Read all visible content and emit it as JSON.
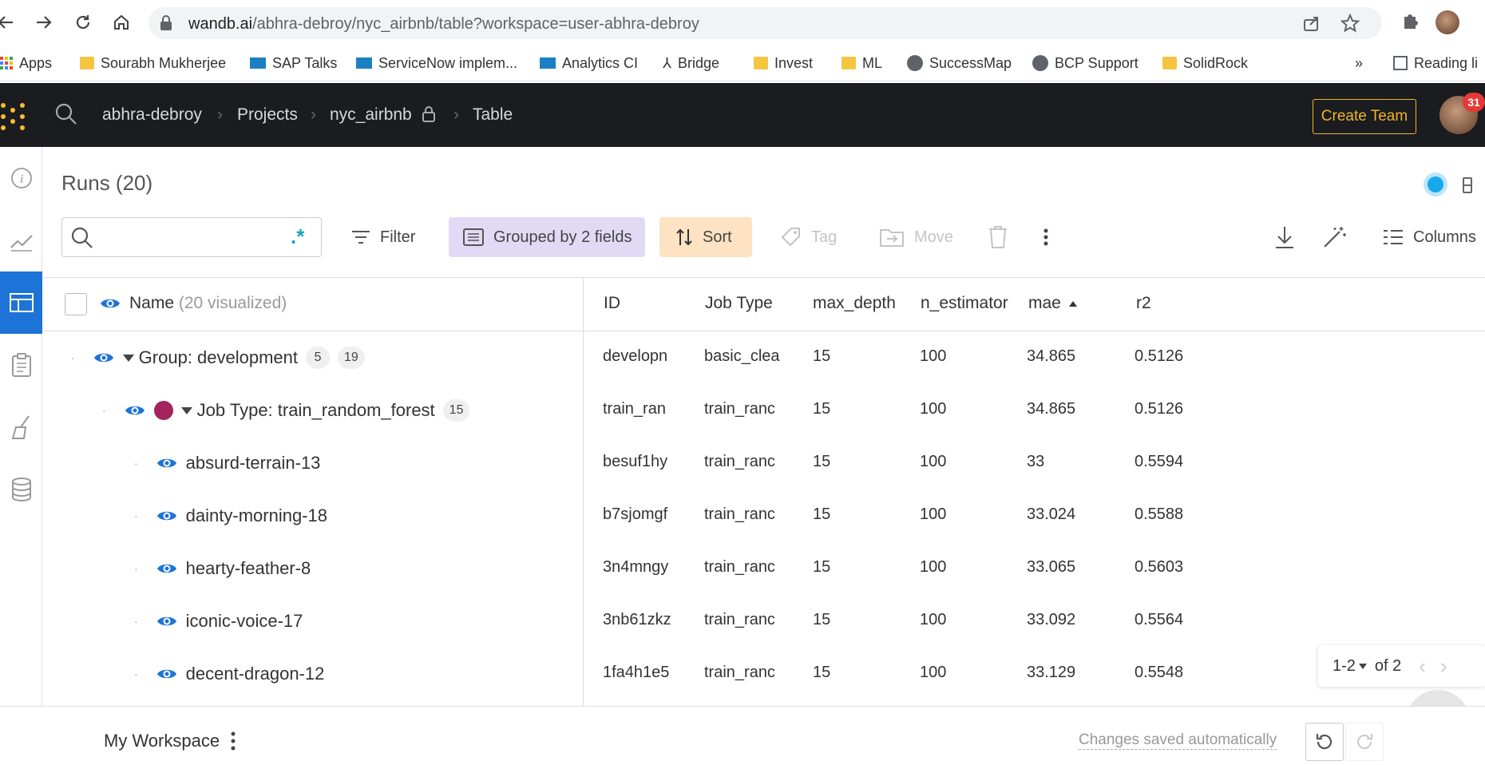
{
  "browser": {
    "url_host": "wandb.ai",
    "url_path": "/abhra-debroy/nyc_airbnb/table?workspace=user-abhra-debroy",
    "bookmarks": [
      "Apps",
      "Sourabh Mukherjee",
      "SAP Talks",
      "ServiceNow implem...",
      "Analytics CI",
      "Bridge",
      "Invest",
      "ML",
      "SuccessMap",
      "BCP Support",
      "SolidRock"
    ],
    "more_bookmarks": "»",
    "reading_list": "Reading li"
  },
  "appbar": {
    "crumbs": [
      "abhra-debroy",
      "Projects",
      "nyc_airbnb",
      "Table"
    ],
    "create_team": "Create Team",
    "notifications": "31"
  },
  "runs": {
    "title": "Runs (20)",
    "search_regex": ".*",
    "toolbar": {
      "filter": "Filter",
      "grouped": "Grouped by 2 fields",
      "sort": "Sort",
      "tag": "Tag",
      "move": "Move",
      "columns": "Columns"
    }
  },
  "table": {
    "name_header": "Name",
    "name_visualized": "(20 visualized)",
    "columns": [
      "ID",
      "Job Type",
      "max_depth",
      "n_estimator",
      "mae",
      "r2"
    ],
    "sorted_column": "mae",
    "group1": {
      "label": "Group: development",
      "count_a": "5",
      "count_b": "19",
      "cells": [
        "developn",
        "basic_clea",
        "15",
        "100",
        "34.865",
        "0.5126"
      ]
    },
    "group2": {
      "label": "Job Type: train_random_forest",
      "count": "15",
      "color": "#a3245e",
      "cells": [
        "train_ran",
        "train_ranc",
        "15",
        "100",
        "34.865",
        "0.5126"
      ]
    },
    "rows": [
      {
        "name": "absurd-terrain-13",
        "cells": [
          "besuf1hy",
          "train_ranc",
          "15",
          "100",
          "33",
          "0.5594"
        ]
      },
      {
        "name": "dainty-morning-18",
        "cells": [
          "b7sjomgf",
          "train_ranc",
          "15",
          "100",
          "33.024",
          "0.5588"
        ]
      },
      {
        "name": "hearty-feather-8",
        "cells": [
          "3n4mngy",
          "train_ranc",
          "15",
          "100",
          "33.065",
          "0.5603"
        ]
      },
      {
        "name": "iconic-voice-17",
        "cells": [
          "3nb61zkz",
          "train_ranc",
          "15",
          "100",
          "33.092",
          "0.5564"
        ]
      },
      {
        "name": "decent-dragon-12",
        "cells": [
          "1fa4h1e5",
          "train_ranc",
          "15",
          "100",
          "33.129",
          "0.5548"
        ]
      }
    ]
  },
  "pager": {
    "range": "1-2",
    "of": "of 2"
  },
  "footer": {
    "workspace": "My Workspace",
    "saved": "Changes saved automatically"
  }
}
